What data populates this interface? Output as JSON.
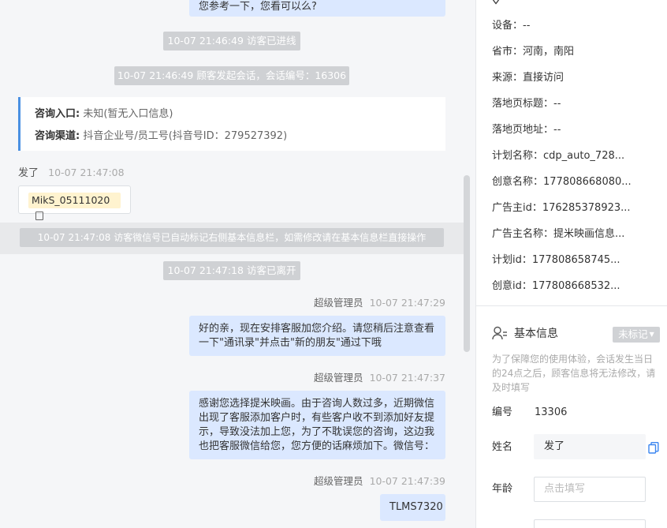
{
  "chat": {
    "top_bubble": "您参考一下，您看可以么?",
    "sys_enter": "10-07 21:46:49 访客已进线",
    "sys_session": "10-07 21:46:49 顾客发起会话，会话编号：16306",
    "consult": {
      "entry_label": "咨询入口:",
      "entry_value": "未知(暂无入口信息)",
      "channel_label": "咨询渠道:",
      "channel_value": "抖音企业号/员工号(抖音号ID：279527392)"
    },
    "visitor": {
      "name": "发了",
      "time": "10-07 21:47:08",
      "wechat": "MikS_05111020"
    },
    "sys_autotag": "10-07 21:47:08 访客微信号已自动标记右侧基本信息栏，如需修改请在基本信息栏直接操作",
    "sys_leave": "10-07 21:47:18 访客已离开",
    "messages": [
      {
        "sender": "超级管理员",
        "time": "10-07 21:47:29",
        "text": "好的亲，现在安排客服加您介绍。请您稍后注意查看一下\"通讯录\"并点击\"新的朋友\"通过下哦"
      },
      {
        "sender": "超级管理员",
        "time": "10-07 21:47:37",
        "text": "感谢您选择提米映画。由于咨询人数过多，近期微信出现了客服添加客户时，有些客户收不到添加好友提示，导致没法加上您，为了不耽误您的咨询，这边我也把客服微信给您，您方便的话麻烦加下。微信号："
      },
      {
        "sender": "超级管理员",
        "time": "10-07 21:47:39",
        "text": "TLMS7320"
      }
    ]
  },
  "side": {
    "details": [
      {
        "label": "设备：",
        "value": "--"
      },
      {
        "label": "省市：",
        "value": "河南，南阳"
      },
      {
        "label": "来源：",
        "value": "直接访问"
      },
      {
        "label": "落地页标题：",
        "value": "--"
      },
      {
        "label": "落地页地址：",
        "value": "--"
      },
      {
        "label": "计划名称：",
        "value": "cdp_auto_728..."
      },
      {
        "label": "创意名称：",
        "value": "177808668080..."
      },
      {
        "label": "广告主id：",
        "value": "176285378923..."
      },
      {
        "label": "广告主名称：",
        "value": "提米映画信息..."
      },
      {
        "label": "计划id：",
        "value": "177808658745..."
      },
      {
        "label": "创意id：",
        "value": "177808668532..."
      }
    ],
    "basic_info": {
      "title": "基本信息",
      "tag_button": "未标记",
      "hint": "为了保障您的使用体验，会话发生当日的24点之后，顾客信息将无法修改，请及时填写",
      "id_label": "编号",
      "id_value": "13306",
      "name_label": "姓名",
      "name_value": "发了",
      "age_label": "年龄",
      "age_placeholder": "点击填写"
    }
  },
  "colors": {
    "accent": "#4a90e2",
    "bubble": "#dbe8ff",
    "sys_bg": "#cfd1d4"
  }
}
